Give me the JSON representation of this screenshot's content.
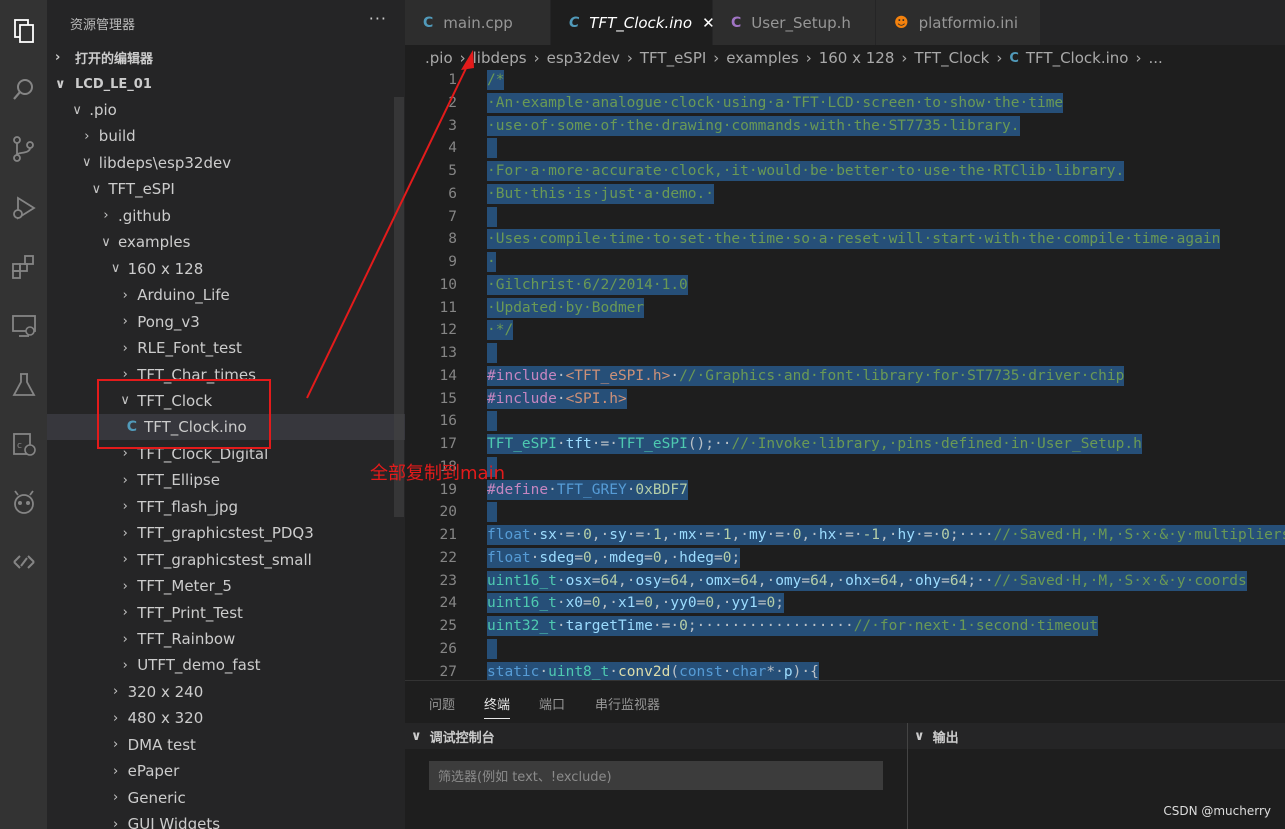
{
  "activity_bar": [
    {
      "name": "explorer-icon"
    },
    {
      "name": "search-icon"
    },
    {
      "name": "source-control-icon"
    },
    {
      "name": "run-debug-icon"
    },
    {
      "name": "extensions-icon"
    },
    {
      "name": "remote-explorer-icon"
    },
    {
      "name": "testing-icon"
    },
    {
      "name": "cpp-map-icon"
    },
    {
      "name": "platformio-icon"
    },
    {
      "name": "live-share-icon"
    }
  ],
  "sidebar": {
    "title": "资源管理器",
    "more": "···",
    "open_editors": "打开的编辑器",
    "workspace": "LCD_LE_01",
    "tree": [
      {
        "label": ".pio",
        "tw": "∨"
      },
      {
        "label": "build",
        "tw": "›"
      },
      {
        "label": "libdeps\\esp32dev",
        "tw": "∨"
      },
      {
        "label": "TFT_eSPI",
        "tw": "∨"
      },
      {
        "label": ".github",
        "tw": "›"
      },
      {
        "label": "examples",
        "tw": "∨"
      },
      {
        "label": "160 x 128",
        "tw": "∨"
      },
      {
        "label": "Arduino_Life",
        "tw": "›"
      },
      {
        "label": "Pong_v3",
        "tw": "›"
      },
      {
        "label": "RLE_Font_test",
        "tw": "›"
      },
      {
        "label": "TFT_Char_times",
        "tw": "›"
      },
      {
        "label": "TFT_Clock",
        "tw": "∨"
      },
      {
        "label": "TFT_Clock.ino",
        "tw": "",
        "file": true
      },
      {
        "label": "TFT_Clock_Digital",
        "tw": "›"
      },
      {
        "label": "TFT_Ellipse",
        "tw": "›"
      },
      {
        "label": "TFT_flash_jpg",
        "tw": "›"
      },
      {
        "label": "TFT_graphicstest_PDQ3",
        "tw": "›"
      },
      {
        "label": "TFT_graphicstest_small",
        "tw": "›"
      },
      {
        "label": "TFT_Meter_5",
        "tw": "›"
      },
      {
        "label": "TFT_Print_Test",
        "tw": "›"
      },
      {
        "label": "TFT_Rainbow",
        "tw": "›"
      },
      {
        "label": "UTFT_demo_fast",
        "tw": "›"
      },
      {
        "label": "320 x 240",
        "tw": "›"
      },
      {
        "label": "480 x 320",
        "tw": "›"
      },
      {
        "label": "DMA test",
        "tw": "›"
      },
      {
        "label": "ePaper",
        "tw": "›"
      },
      {
        "label": "Generic",
        "tw": "›"
      },
      {
        "label": "GUI Widgets",
        "tw": "›"
      }
    ]
  },
  "tabs": [
    {
      "label": "main.cpp",
      "icon": "C",
      "icon_color": "#519aba",
      "active": false
    },
    {
      "label": "TFT_Clock.ino",
      "icon": "C",
      "icon_color": "#519aba",
      "active": true,
      "close": "✕"
    },
    {
      "label": "User_Setup.h",
      "icon": "C",
      "icon_color": "#a074c4",
      "active": false
    },
    {
      "label": "platformio.ini",
      "icon": "☻",
      "icon_color": "#f5820d",
      "active": false
    }
  ],
  "breadcrumbs": [
    ".pio",
    "libdeps",
    "esp32dev",
    "TFT_eSPI",
    "examples",
    "160 x 128",
    "TFT_Clock",
    "TFT_Clock.ino",
    "..."
  ],
  "breadcrumb_sep": "›",
  "code": [
    {
      "n": "1",
      "segs": [
        [
          "/*",
          "c"
        ]
      ]
    },
    {
      "n": "2",
      "segs": [
        [
          "·An·example·analogue·clock·using·a·TFT·LCD·screen·to·show·the·time",
          "c"
        ]
      ]
    },
    {
      "n": "3",
      "segs": [
        [
          "·use·of·some·of·the·drawing·commands·with·the·ST7735·library.",
          "c"
        ]
      ]
    },
    {
      "n": "4",
      "segs": []
    },
    {
      "n": "5",
      "segs": [
        [
          "·For·a·more·accurate·clock,·it·would·be·better·to·use·the·RTClib·library.",
          "c"
        ]
      ]
    },
    {
      "n": "6",
      "segs": [
        [
          "·But·this·is·just·a·demo.·",
          "c"
        ]
      ]
    },
    {
      "n": "7",
      "segs": []
    },
    {
      "n": "8",
      "segs": [
        [
          "·Uses·compile·time·to·set·the·time·so·a·reset·will·start·with·the·compile·time·again",
          "c"
        ]
      ]
    },
    {
      "n": "9",
      "segs": [
        [
          "·",
          "c"
        ]
      ]
    },
    {
      "n": "10",
      "segs": [
        [
          "·Gilchrist·6/2/2014·1.0",
          "c"
        ]
      ]
    },
    {
      "n": "11",
      "segs": [
        [
          "·Updated·by·Bodmer",
          "c"
        ]
      ]
    },
    {
      "n": "12",
      "segs": [
        [
          "·*/",
          "c"
        ]
      ]
    },
    {
      "n": "13",
      "segs": []
    },
    {
      "n": "14",
      "segs": [
        [
          "#include",
          "p"
        ],
        [
          "·",
          "t"
        ],
        [
          "<TFT_eSPI.h>",
          "s"
        ],
        [
          "·",
          "t"
        ],
        [
          "//·Graphics·and·font·library·for·ST7735·driver·chip",
          "c"
        ]
      ]
    },
    {
      "n": "15",
      "segs": [
        [
          "#include",
          "p"
        ],
        [
          "·",
          "t"
        ],
        [
          "<SPI.h>",
          "s"
        ]
      ]
    },
    {
      "n": "16",
      "segs": []
    },
    {
      "n": "17",
      "segs": [
        [
          "TFT_eSPI",
          "ty"
        ],
        [
          "·",
          "t"
        ],
        [
          "tft",
          "v"
        ],
        [
          "·=·",
          "t"
        ],
        [
          "TFT_eSPI",
          "ty"
        ],
        [
          "();",
          "t"
        ],
        [
          "··",
          "t"
        ],
        [
          "//·Invoke·library,·pins·defined·in·User_Setup.h",
          "c"
        ]
      ]
    },
    {
      "n": "18",
      "segs": []
    },
    {
      "n": "19",
      "segs": [
        [
          "#define",
          "p"
        ],
        [
          "·",
          "t"
        ],
        [
          "TFT_GREY",
          "m"
        ],
        [
          "·",
          "t"
        ],
        [
          "0xBDF7",
          "nm"
        ]
      ]
    },
    {
      "n": "20",
      "segs": []
    },
    {
      "n": "21",
      "segs": [
        [
          "float",
          "k"
        ],
        [
          "·",
          "t"
        ],
        [
          "sx",
          "v"
        ],
        [
          "·=·",
          "t"
        ],
        [
          "0",
          "nm"
        ],
        [
          ",·",
          "t"
        ],
        [
          "sy",
          "v"
        ],
        [
          "·=·",
          "t"
        ],
        [
          "1",
          "nm"
        ],
        [
          ",·",
          "t"
        ],
        [
          "mx",
          "v"
        ],
        [
          "·=·",
          "t"
        ],
        [
          "1",
          "nm"
        ],
        [
          ",·",
          "t"
        ],
        [
          "my",
          "v"
        ],
        [
          "·=·",
          "t"
        ],
        [
          "0",
          "nm"
        ],
        [
          ",·",
          "t"
        ],
        [
          "hx",
          "v"
        ],
        [
          "·=·",
          "t"
        ],
        [
          "-1",
          "nm"
        ],
        [
          ",·",
          "t"
        ],
        [
          "hy",
          "v"
        ],
        [
          "·=·",
          "t"
        ],
        [
          "0",
          "nm"
        ],
        [
          ";····",
          "t"
        ],
        [
          "//·Saved·H,·M,·S·x·&·y·multipliers",
          "c"
        ]
      ]
    },
    {
      "n": "22",
      "segs": [
        [
          "float",
          "k"
        ],
        [
          "·",
          "t"
        ],
        [
          "sdeg",
          "v"
        ],
        [
          "=",
          "t"
        ],
        [
          "0",
          "nm"
        ],
        [
          ",·",
          "t"
        ],
        [
          "mdeg",
          "v"
        ],
        [
          "=",
          "t"
        ],
        [
          "0",
          "nm"
        ],
        [
          ",·",
          "t"
        ],
        [
          "hdeg",
          "v"
        ],
        [
          "=",
          "t"
        ],
        [
          "0",
          "nm"
        ],
        [
          ";",
          "t"
        ]
      ]
    },
    {
      "n": "23",
      "segs": [
        [
          "uint16_t",
          "ty"
        ],
        [
          "·",
          "t"
        ],
        [
          "osx",
          "v"
        ],
        [
          "=",
          "t"
        ],
        [
          "64",
          "nm"
        ],
        [
          ",·",
          "t"
        ],
        [
          "osy",
          "v"
        ],
        [
          "=",
          "t"
        ],
        [
          "64",
          "nm"
        ],
        [
          ",·",
          "t"
        ],
        [
          "omx",
          "v"
        ],
        [
          "=",
          "t"
        ],
        [
          "64",
          "nm"
        ],
        [
          ",·",
          "t"
        ],
        [
          "omy",
          "v"
        ],
        [
          "=",
          "t"
        ],
        [
          "64",
          "nm"
        ],
        [
          ",·",
          "t"
        ],
        [
          "ohx",
          "v"
        ],
        [
          "=",
          "t"
        ],
        [
          "64",
          "nm"
        ],
        [
          ",·",
          "t"
        ],
        [
          "ohy",
          "v"
        ],
        [
          "=",
          "t"
        ],
        [
          "64",
          "nm"
        ],
        [
          ";··",
          "t"
        ],
        [
          "//·Saved·H,·M,·S·x·&·y·coords",
          "c"
        ]
      ]
    },
    {
      "n": "24",
      "segs": [
        [
          "uint16_t",
          "ty"
        ],
        [
          "·",
          "t"
        ],
        [
          "x0",
          "v"
        ],
        [
          "=",
          "t"
        ],
        [
          "0",
          "nm"
        ],
        [
          ",·",
          "t"
        ],
        [
          "x1",
          "v"
        ],
        [
          "=",
          "t"
        ],
        [
          "0",
          "nm"
        ],
        [
          ",·",
          "t"
        ],
        [
          "yy0",
          "v"
        ],
        [
          "=",
          "t"
        ],
        [
          "0",
          "nm"
        ],
        [
          ",·",
          "t"
        ],
        [
          "yy1",
          "v"
        ],
        [
          "=",
          "t"
        ],
        [
          "0",
          "nm"
        ],
        [
          ";",
          "t"
        ]
      ]
    },
    {
      "n": "25",
      "segs": [
        [
          "uint32_t",
          "ty"
        ],
        [
          "·",
          "t"
        ],
        [
          "targetTime",
          "v"
        ],
        [
          "·=·",
          "t"
        ],
        [
          "0",
          "nm"
        ],
        [
          ";··················",
          "t"
        ],
        [
          "//·for·next·1·second·timeout",
          "c"
        ]
      ]
    },
    {
      "n": "26",
      "segs": []
    },
    {
      "n": "27",
      "segs": [
        [
          "static",
          "k"
        ],
        [
          "·",
          "t"
        ],
        [
          "uint8_t",
          "ty"
        ],
        [
          "·",
          "t"
        ],
        [
          "conv2d",
          "f"
        ],
        [
          "(",
          "t"
        ],
        [
          "const",
          "k"
        ],
        [
          "·",
          "t"
        ],
        [
          "char",
          "k"
        ],
        [
          "*·",
          "t"
        ],
        [
          "p",
          "v"
        ],
        [
          ")·{",
          "t"
        ]
      ]
    }
  ],
  "panel": {
    "tabs": [
      {
        "label": "问题",
        "active": false
      },
      {
        "label": "终端",
        "active": true
      },
      {
        "label": "端口",
        "active": false
      },
      {
        "label": "串行监视器",
        "active": false
      }
    ],
    "debug_console": "调试控制台",
    "output": "输出",
    "filter_placeholder": "筛选器(例如 text、!exclude)",
    "chevron": "∨"
  },
  "annotation": "全部复制到main",
  "watermark": "CSDN @mucherry",
  "colors": {
    "c": "#6a9955",
    "p": "#c586c0",
    "s": "#ce9178",
    "ty": "#4ec9b0",
    "v": "#9cdcfe",
    "k": "#569cd6",
    "nm": "#b5cea8",
    "m": "#569cd6",
    "f": "#dcdcaa",
    "t": "#d4d4d4"
  }
}
